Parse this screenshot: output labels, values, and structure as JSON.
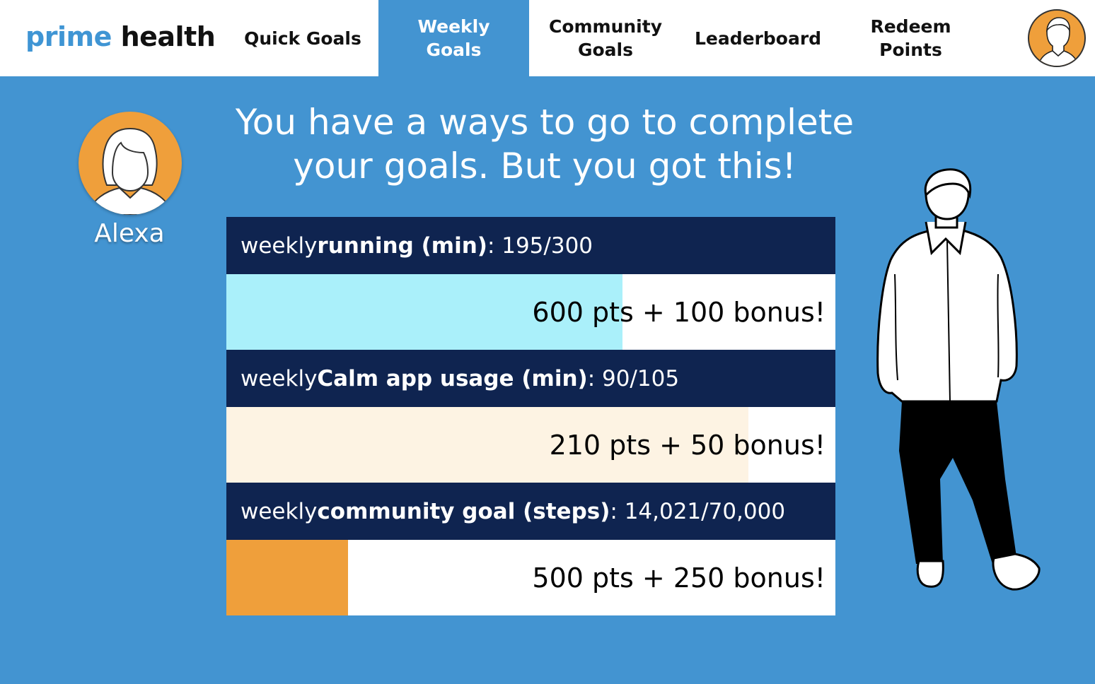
{
  "app": {
    "logo_part1": "prime",
    "logo_part2": " health"
  },
  "nav": {
    "tabs": [
      {
        "label": "Quick Goals",
        "active": false
      },
      {
        "label": "Weekly\nGoals",
        "active": true
      },
      {
        "label": "Community\nGoals",
        "active": false
      },
      {
        "label": "Leaderboard",
        "active": false
      },
      {
        "label": "Redeem\nPoints",
        "active": false
      }
    ]
  },
  "profile": {
    "name": "Alexa",
    "avatar_icon": "user-female-icon"
  },
  "headline": "You have a ways to go to complete your goals. But you got this!",
  "goals": [
    {
      "prefix": "weekly ",
      "bold": "running (min)",
      "suffix": ": 195/300",
      "progress": 0.65,
      "fill_color": "#aaf0fa",
      "reward": "600 pts + 100 bonus!"
    },
    {
      "prefix": "weekly ",
      "bold": "Calm app usage (min)",
      "suffix": ": 90/105",
      "progress": 0.857,
      "fill_color": "#fdf3e3",
      "reward": "210 pts + 50 bonus!"
    },
    {
      "prefix": "weekly ",
      "bold": "community goal (steps)",
      "suffix": ": 14,021/70,000",
      "progress": 0.2,
      "fill_color": "#ef9f3b",
      "reward": "500 pts + 250 bonus!"
    }
  ],
  "colors": {
    "background": "#4394d1",
    "header_dark": "#0f2450",
    "accent_orange": "#ef9f3b",
    "logo_blue": "#3f95d4"
  }
}
